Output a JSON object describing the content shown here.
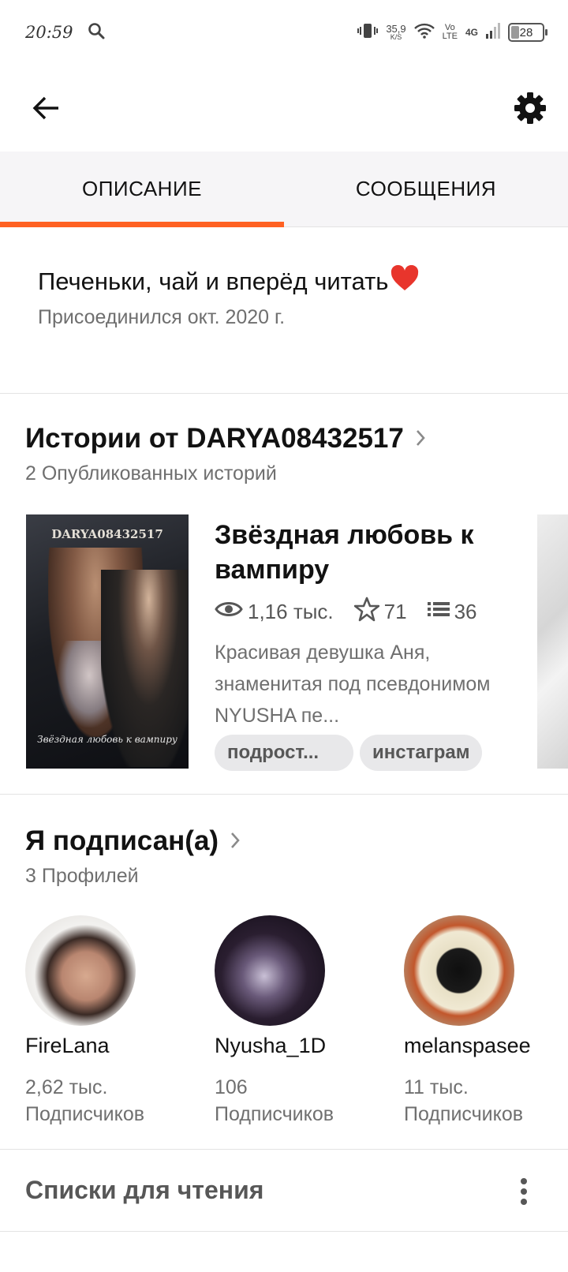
{
  "status_bar": {
    "time": "20:59",
    "speed_value": "35,9",
    "speed_unit": "K/S",
    "volte_top": "Vo",
    "volte_bottom": "LTE",
    "network": "4G",
    "battery": "28"
  },
  "tabs": [
    {
      "label": "ОПИСАНИЕ",
      "active": true
    },
    {
      "label": "СООБЩЕНИЯ",
      "active": false
    }
  ],
  "about": {
    "tagline": "Печеньки, чай и вперёд читать",
    "joined": "Присоединился окт. 2020 г."
  },
  "stories": {
    "title": "Истории от DARYA08432517",
    "count": "2 Опубликованных историй",
    "item": {
      "cover_author": "DARYA08432517",
      "cover_title": "Звёздная любовь к вампиру",
      "title": "Звёздная любовь к вампиру",
      "reads": "1,16 тыс.",
      "votes": "71",
      "parts": "36",
      "description": "Красивая девушка Аня, знаменитая под псевдонимом NYUSHA пе...",
      "tags": [
        "подрост...",
        "инстаграм"
      ]
    }
  },
  "following": {
    "title": "Я подписан(а)",
    "count": "3 Профилей",
    "profiles": [
      {
        "name": "FireLana",
        "followers": "2,62 тыс.",
        "label": "Подписчиков"
      },
      {
        "name": "Nyusha_1D",
        "followers": "106",
        "label": "Подписчиков"
      },
      {
        "name": "melanspasee",
        "followers": "11 тыс.",
        "label": "Подписчиков"
      }
    ]
  },
  "reading_lists": {
    "title": "Списки для чтения"
  },
  "colors": {
    "accent": "#ff6122",
    "heart": "#e8352c"
  }
}
